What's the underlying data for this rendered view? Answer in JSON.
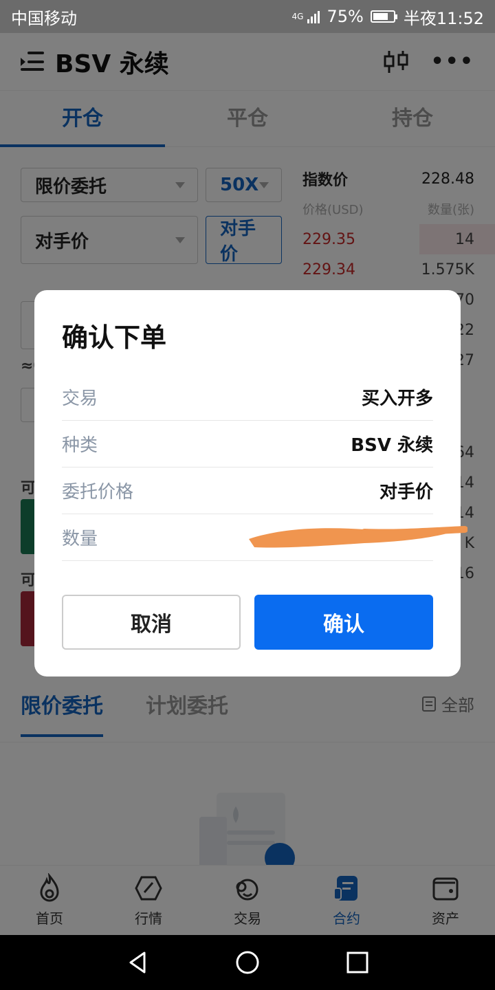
{
  "status_bar": {
    "carrier": "中国移动",
    "network": "4G",
    "battery": "75%",
    "time": "半夜11:52"
  },
  "header": {
    "title": "BSV 永续",
    "menu_icon": "menu-icon",
    "chart_icon": "candlestick-icon",
    "more_icon": "more-icon"
  },
  "tabs": [
    "开仓",
    "平仓",
    "持仓"
  ],
  "order_form": {
    "order_type": "限价委托",
    "leverage": "50X",
    "price_mode": "对手价",
    "price_button": "对手价"
  },
  "order_book": {
    "index_label": "指数价",
    "index_value": "228.48",
    "price_header": "价格(USD)",
    "qty_header": "数量(张)",
    "asks": [
      {
        "price": "229.35",
        "qty": "14"
      },
      {
        "price": "229.34",
        "qty": "1.575K"
      }
    ],
    "visible_tails": [
      "70",
      "22",
      "27",
      "64",
      "14",
      "14",
      "K",
      "16"
    ]
  },
  "side_fragments": {
    "approx": "≈0",
    "can_open_1": "可",
    "can_open_2": "可"
  },
  "order_tabs": {
    "limit": "限价委托",
    "plan": "计划委托",
    "all": "全部"
  },
  "bottom_nav": [
    {
      "label": "首页",
      "icon": "flame-icon"
    },
    {
      "label": "行情",
      "icon": "compass-icon"
    },
    {
      "label": "交易",
      "icon": "exchange-icon"
    },
    {
      "label": "合约",
      "icon": "contract-icon",
      "active": true
    },
    {
      "label": "资产",
      "icon": "wallet-icon"
    }
  ],
  "dialog": {
    "title": "确认下单",
    "rows": [
      {
        "label": "交易",
        "value": "买入开多"
      },
      {
        "label": "种类",
        "value": "BSV 永续"
      },
      {
        "label": "委托价格",
        "value": "对手价"
      },
      {
        "label": "数量",
        "value": ""
      }
    ],
    "cancel": "取消",
    "confirm": "确认"
  },
  "colors": {
    "accent": "#1565c0",
    "confirm": "#0a6cf0",
    "ask": "#c62828",
    "buy": "#1b7a55",
    "sell": "#a8283a"
  }
}
